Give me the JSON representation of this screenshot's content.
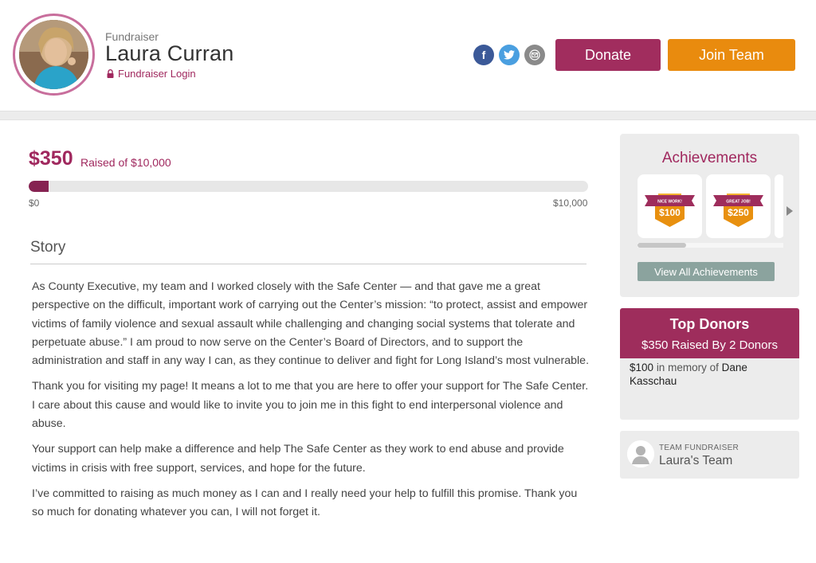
{
  "header": {
    "role": "Fundraiser",
    "name": "Laura Curran",
    "login_label": "Fundraiser Login",
    "social": {
      "facebook_glyph": "f",
      "twitter_glyph": "🐦",
      "email_glyph": "✉"
    },
    "donate_label": "Donate",
    "join_label": "Join Team",
    "colors": {
      "donate": "#a12d5e",
      "join": "#e98b0e",
      "accent": "#a0285e"
    }
  },
  "progress": {
    "raised": "$350",
    "raised_of": "Raised of $10,000",
    "fraction": 0.035,
    "min_label": "$0",
    "max_label": "$10,000"
  },
  "story": {
    "title": "Story",
    "paragraphs": [
      "As County Executive, my team and I worked closely with the Safe Center — and that gave me a great perspective on the difficult, important work of carrying out the Center’s mission: “to protect, assist and empower victims of family violence and sexual assault while challenging and changing social systems that tolerate and perpetuate abuse.” I am proud to now serve on the Center’s Board of Directors, and to support the administration and staff in any way I can, as they continue to deliver and fight for Long Island’s most vulnerable.",
      "Thank you for visiting my page! It means a lot to me that you are here to offer your support for The Safe Center. I care about this cause and would like to invite you to join me in this fight to end interpersonal violence and abuse.",
      "Your support can help make a difference and help The Safe Center as they work to end abuse and provide victims in crisis with free support, services, and hope for the future.",
      "I’ve committed to raising as much money as I can and I really need your help to fulfill this promise. Thank you so much for donating whatever you can, I will not forget it."
    ]
  },
  "achievements": {
    "title": "Achievements",
    "badges": [
      {
        "ribbon": "NICE WORK!",
        "amount": "$100"
      },
      {
        "ribbon": "GREAT JOB!",
        "amount": "$250"
      }
    ],
    "view_all_label": "View All Achievements"
  },
  "top_donors": {
    "title": "Top Donors",
    "subtitle": "$350 Raised By 2 Donors",
    "entries": [
      {
        "amount": "$100",
        "memory_text": "in memory of",
        "name": "Dane Kasschau"
      }
    ]
  },
  "team": {
    "label": "TEAM FUNDRAISER",
    "name": "Laura's Team"
  }
}
